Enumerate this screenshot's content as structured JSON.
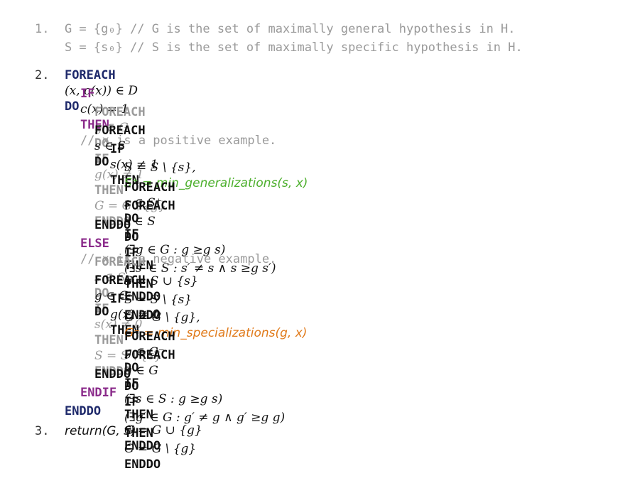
{
  "lines": {
    "l1": {
      "num": "1.",
      "text": "G = {g₀} // G is the set of maximally general hypothesis in H."
    },
    "l1b": {
      "text": "S = {s₀} // S is the set of maximally specific hypothesis in H."
    },
    "l2": {
      "num": "2.",
      "kw1": "FOREACH",
      "expr": "(x, c(x)) ∈ D",
      "kw2": "DO"
    },
    "l3": {
      "kw1": "IF",
      "expr": "c(x) = 1",
      "kw2": "THEN",
      "comment": "// x is a positive example."
    },
    "l4": {
      "text_kw1": "FOREACH",
      "expr1": "g ∈ G",
      "kw2": "DO",
      "kw3": "IF",
      "expr2": "g(x) ≠ 1",
      "kw4": "THEN",
      "expr3": "G = G \\ {g}",
      "kw5": "ENDDO"
    },
    "l5": {
      "kw1": "FOREACH",
      "expr": "s ∈ S",
      "kw2": "DO"
    },
    "l6": {
      "kw1": "IF",
      "expr": "s(x) ≠ 1",
      "kw2": "THEN"
    },
    "l7": {
      "expr": "S = S \\ {s},",
      "fn": "S⁺ = min_generalizations(s, x)"
    },
    "l8": {
      "kw1": "FOREACH",
      "expr1": "s ∈ S⁺",
      "kw2": "DO",
      "kw3": "IF",
      "expr2": "(∃g ∈ G : g ≥g s)",
      "kw4": "THEN",
      "expr3": "S = S ∪ {s}",
      "kw5": "ENDDO"
    },
    "l9": {
      "kw1": "FOREACH",
      "expr1": "s ∈ S",
      "kw2": "DO",
      "kw3": "IF",
      "expr2": "(∃s′ ∈ S : s′ ≠ s ∧ s ≥g s′)",
      "kw4": "THEN",
      "expr3": "S = S \\ {s}",
      "kw5": "ENDDO"
    },
    "l10": {
      "kw": "ENDDO"
    },
    "l11": {
      "kw": "ELSE",
      "comment": "// x is a negative example."
    },
    "l12": {
      "kw1": "FOREACH",
      "expr1": "s ∈ S",
      "kw2": "DO",
      "kw3": "IF",
      "expr2": "s(x) ≠ 0",
      "kw4": "THEN",
      "expr3": "S = S \\ {s}",
      "kw5": "ENDDO"
    },
    "l13": {
      "kw1": "FOREACH",
      "expr": "g ∈ G",
      "kw2": "DO"
    },
    "l14": {
      "kw1": "IF",
      "expr": "g(x) ≠ 0",
      "kw2": "THEN"
    },
    "l15": {
      "expr": "G = G \\ {g},",
      "fn": "G⁻ = min_specializations(g, x)"
    },
    "l16": {
      "kw1": "FOREACH",
      "expr1": "g ∈ G⁻",
      "kw2": "DO",
      "kw3": "IF",
      "expr2": "(∃s ∈ S : g ≥g s)",
      "kw4": "THEN",
      "expr3": "G = G ∪ {g}",
      "kw5": "ENDDO"
    },
    "l17": {
      "kw1": "FOREACH",
      "expr1": "g ∈ G",
      "kw2": "DO",
      "kw3": "IF",
      "expr2": "(∃g′ ∈ G : g′ ≠ g ∧ g′ ≥g g)",
      "kw4": "THEN",
      "expr3": "G = G \\ {g}",
      "kw5": "ENDDO"
    },
    "l18": {
      "kw": "ENDDO"
    },
    "l19": {
      "kw": "ENDIF"
    },
    "l20": {
      "kw": "ENDDO"
    },
    "l21": {
      "num": "3.",
      "text": "return(G, S)"
    }
  },
  "colors": {
    "navy": "#1f2a6b",
    "purple": "#8a2a8a",
    "gray": "#9a9a9a",
    "green": "#4caf2c",
    "orange": "#e07a1a"
  }
}
